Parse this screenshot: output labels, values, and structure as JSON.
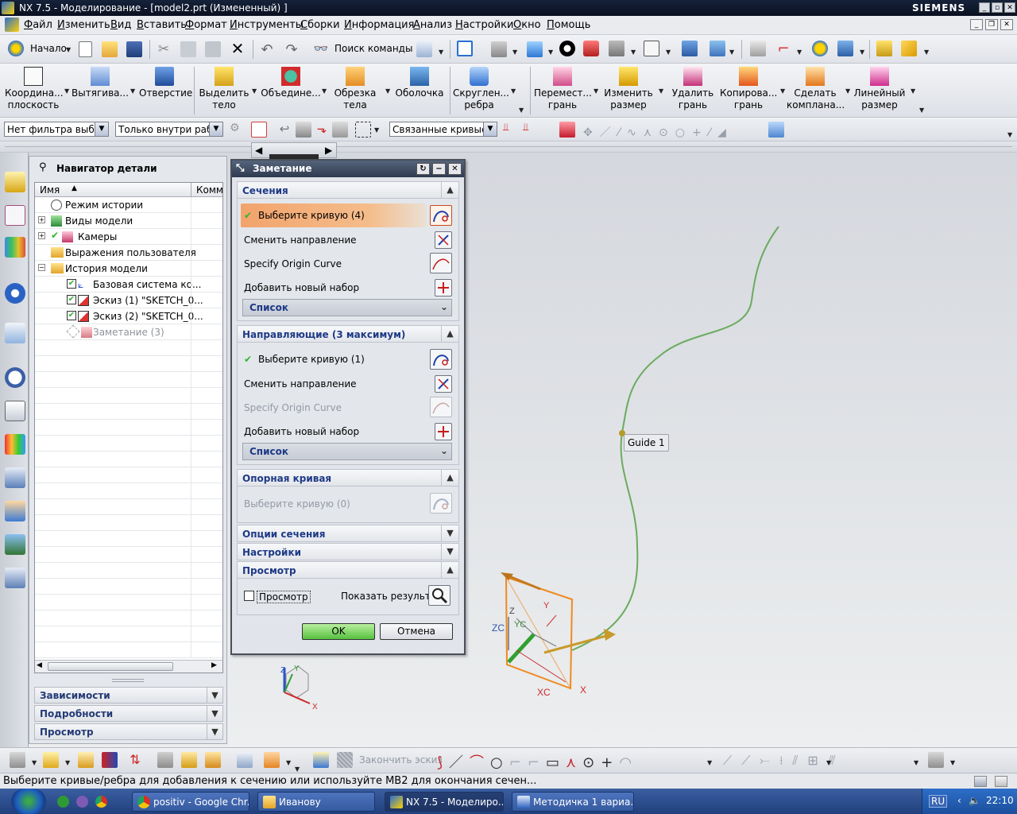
{
  "window": {
    "title": "NX 7.5 - Моделирование - [model2.prt (Измененный) ]",
    "brand": "SIEMENS",
    "controls": [
      "_",
      "▫",
      "✕"
    ]
  },
  "menubar": {
    "items": [
      "Файл",
      "Изменить",
      "Вид",
      "Вставить",
      "Формат",
      "Инструменты",
      "Сборки",
      "Информация",
      "Анализ",
      "Настройки",
      "Окно",
      "Помощь"
    ],
    "mdi_controls": [
      "_",
      "❐",
      "✕"
    ]
  },
  "toolbar1": {
    "start_label": "Начало",
    "command_search_label": "Поиск команды"
  },
  "toolbar2": {
    "buttons": [
      "Координа...\nплоскость",
      "Вытягива...",
      "Отверстие",
      "Выделить\nтело",
      "Объедине...",
      "Обрезка\nтела",
      "Оболочка",
      "Скруглен...\nребра",
      "Перемест...\nгрань",
      "Изменить\nразмер",
      "Удалить\nгрань",
      "Копирова...\nгрань",
      "Сделать\nкомплана...",
      "Линейный\nразмер"
    ]
  },
  "selection_bar": {
    "type_filter": "Нет фильтра выбор",
    "scope": "Только внутри рабо",
    "curve_rule": "Связанные кривые"
  },
  "navigator": {
    "title": "Навигатор детали",
    "columns": [
      "Имя",
      "Комм"
    ],
    "rows": [
      {
        "label": "Режим истории",
        "state": "normal"
      },
      {
        "label": "Виды модели",
        "state": "normal"
      },
      {
        "label": "Камеры",
        "state": "normal"
      },
      {
        "label": "Выражения пользователя",
        "state": "normal"
      },
      {
        "label": "История модели",
        "state": "normal"
      },
      {
        "label": "Базовая система ко...",
        "state": "normal"
      },
      {
        "label": "Эскиз (1) \"SKETCH_0...",
        "state": "normal"
      },
      {
        "label": "Эскиз (2) \"SKETCH_0...",
        "state": "normal"
      },
      {
        "label": "Заметание (3)",
        "state": "dim"
      }
    ],
    "panels": [
      "Зависимости",
      "Подробности",
      "Просмотр"
    ]
  },
  "dialog": {
    "title": "Заметание",
    "sections_group": {
      "title": "Сечения",
      "select_curve": "Выберите кривую (4)",
      "reverse": "Сменить направление",
      "origin": "Specify Origin Curve",
      "add_set": "Добавить новый набор",
      "list": "Список"
    },
    "guides_group": {
      "title": "Направляющие (3 максимум)",
      "select_curve": "Выберите кривую (1)",
      "reverse": "Сменить направление",
      "origin": "Specify Origin Curve",
      "add_set": "Добавить новый набор",
      "list": "Список"
    },
    "spine_group": {
      "title": "Опорная кривая",
      "select_curve": "Выберите кривую (0)"
    },
    "section_options": "Опции сечения",
    "settings": "Настройки",
    "preview_group": {
      "title": "Просмотр",
      "checkbox_label": "Просмотр",
      "show_result": "Показать результат"
    },
    "ok": "OK",
    "cancel": "Отмена"
  },
  "viewport": {
    "guide_label": "Guide 1",
    "csys_labels": [
      "ZC",
      "YC",
      "XC",
      "Z",
      "Y",
      "X"
    ],
    "triad_labels": [
      "Z",
      "Y",
      "X"
    ]
  },
  "bottom_toolbar": {
    "finish_sketch": "Закончить эскиз"
  },
  "status": {
    "message": "Выберите кривые/ребра для добавления к сечению или используйте MB2 для окончания сечен..."
  },
  "taskbar": {
    "tasks": [
      "positiv - Google Chr...",
      "Иванову",
      "NX 7.5 - Моделиро...",
      "Методичка 1 вариа..."
    ],
    "lang": "RU",
    "time": "22:10"
  },
  "colors": {
    "accent_orange": "#f0a060",
    "check_green": "#2fb52f",
    "curve_green": "#6aab5e",
    "csys_orange": "#f08a20",
    "group_blue": "#1e3a86"
  }
}
